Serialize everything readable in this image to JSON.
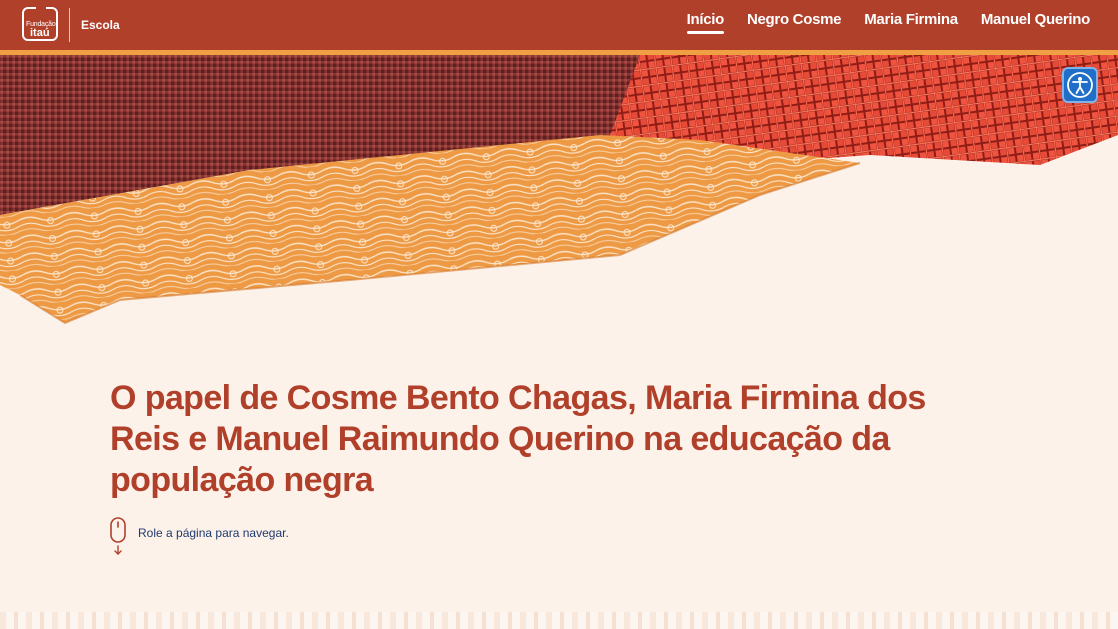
{
  "header": {
    "logo": {
      "text_small": "Fundação",
      "text_big": "itaú"
    },
    "site_name": "Escola",
    "nav": [
      {
        "label": "Início",
        "active": true
      },
      {
        "label": "Negro Cosme",
        "active": false
      },
      {
        "label": "Maria Firmina",
        "active": false
      },
      {
        "label": "Manuel Querino",
        "active": false
      }
    ]
  },
  "accessibility": {
    "icon": "accessibility-icon"
  },
  "main": {
    "title": "O papel de Cosme Bento Chagas, Maria Firmina dos Reis e Manuel Raimundo Querino na educação da população negra",
    "scroll_hint": "Role a página para navegar."
  },
  "colors": {
    "header_bg": "#b1402b",
    "header_border": "#f0a043",
    "page_bg": "#fcf2ea",
    "title": "#b1402b",
    "hint_text": "#1f3a6e",
    "a11y_button": "#1f6fc8"
  }
}
